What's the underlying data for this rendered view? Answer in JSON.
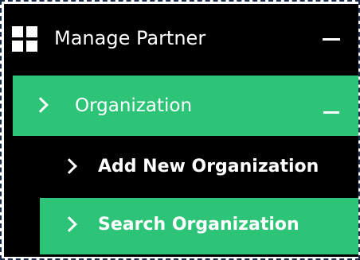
{
  "menu": {
    "manage_partner": {
      "label": "Manage Partner",
      "icon": "grid-icon",
      "toggle_icon": "minus-icon"
    },
    "organization": {
      "label": "Organization",
      "icon": "chevron-right-icon",
      "toggle_icon": "minus-icon",
      "expanded": true
    },
    "items": [
      {
        "label": "Add New Organization",
        "icon": "chevron-right-icon",
        "active": false
      },
      {
        "label": "Search Organization",
        "icon": "chevron-right-icon",
        "active": true
      }
    ]
  },
  "colors": {
    "background": "#000000",
    "active": "#2ec478",
    "text": "#ffffff"
  }
}
